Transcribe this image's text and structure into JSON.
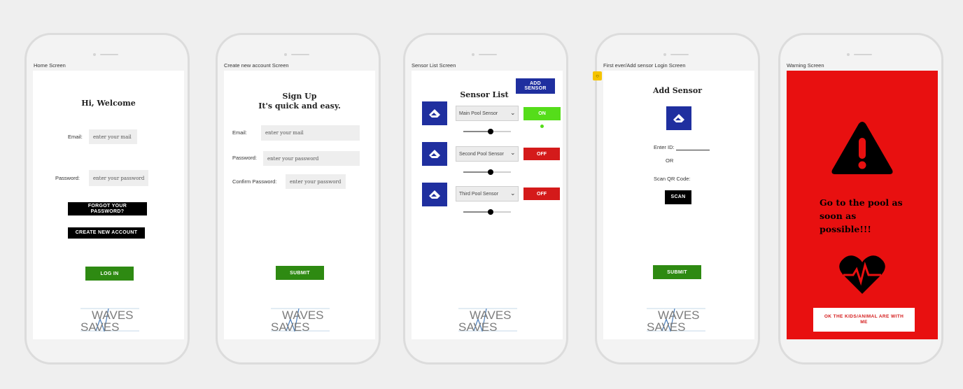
{
  "logo": {
    "line1": "WAVES",
    "line2": "SAVES"
  },
  "screens": {
    "home": {
      "label": "Home Screen",
      "title": "Hi, Welcome",
      "email_label": "Email:",
      "email_placeholder": "enter your mail",
      "password_label": "Password:",
      "password_placeholder": "enter your password",
      "forgot_button": "FORGOT YOUR PASSWORD?",
      "create_button": "CREATE NEW ACCOUNT",
      "login_button": "LOG IN"
    },
    "signup": {
      "label": "Create new account Screen",
      "title_line1": "Sign Up",
      "title_line2": "It's quick and easy.",
      "email_label": "Email:",
      "email_placeholder": "enter your mail",
      "password_label": "Password:",
      "password_placeholder": "enter your password",
      "confirm_label": "Confirm Password:",
      "confirm_placeholder": "enter your password",
      "submit_button": "SUBMIT"
    },
    "sensors": {
      "label": "Sensor List Screen",
      "add_button": "ADD SENSOR",
      "title": "Sensor List",
      "items": [
        {
          "name": "Main Pool Sensor",
          "state": "ON",
          "slider": 0.5
        },
        {
          "name": "Second Pool Sensor",
          "state": "OFF",
          "slider": 0.5
        },
        {
          "name": "Third Pool Sensor",
          "state": "OFF",
          "slider": 0.5
        }
      ]
    },
    "add_sensor": {
      "label": "First ever/Add sensor Login Screen",
      "title": "Add Sensor",
      "enter_id": "Enter ID:",
      "or": "OR",
      "scan_qr": "Scan QR Code:",
      "scan_button": "SCAN",
      "submit_button": "SUBMIT"
    },
    "warning": {
      "label": "Warning Screen",
      "message": "Go to the pool as soon as possible!!!",
      "ok_button": "OK THE KIDS/ANIMAL ARE WITH ME"
    }
  },
  "colors": {
    "green": "#2e8a12",
    "on_green": "#55dd1a",
    "off_red": "#d41a1a",
    "blue": "#1f2f9f",
    "warning_red": "#e81010"
  }
}
